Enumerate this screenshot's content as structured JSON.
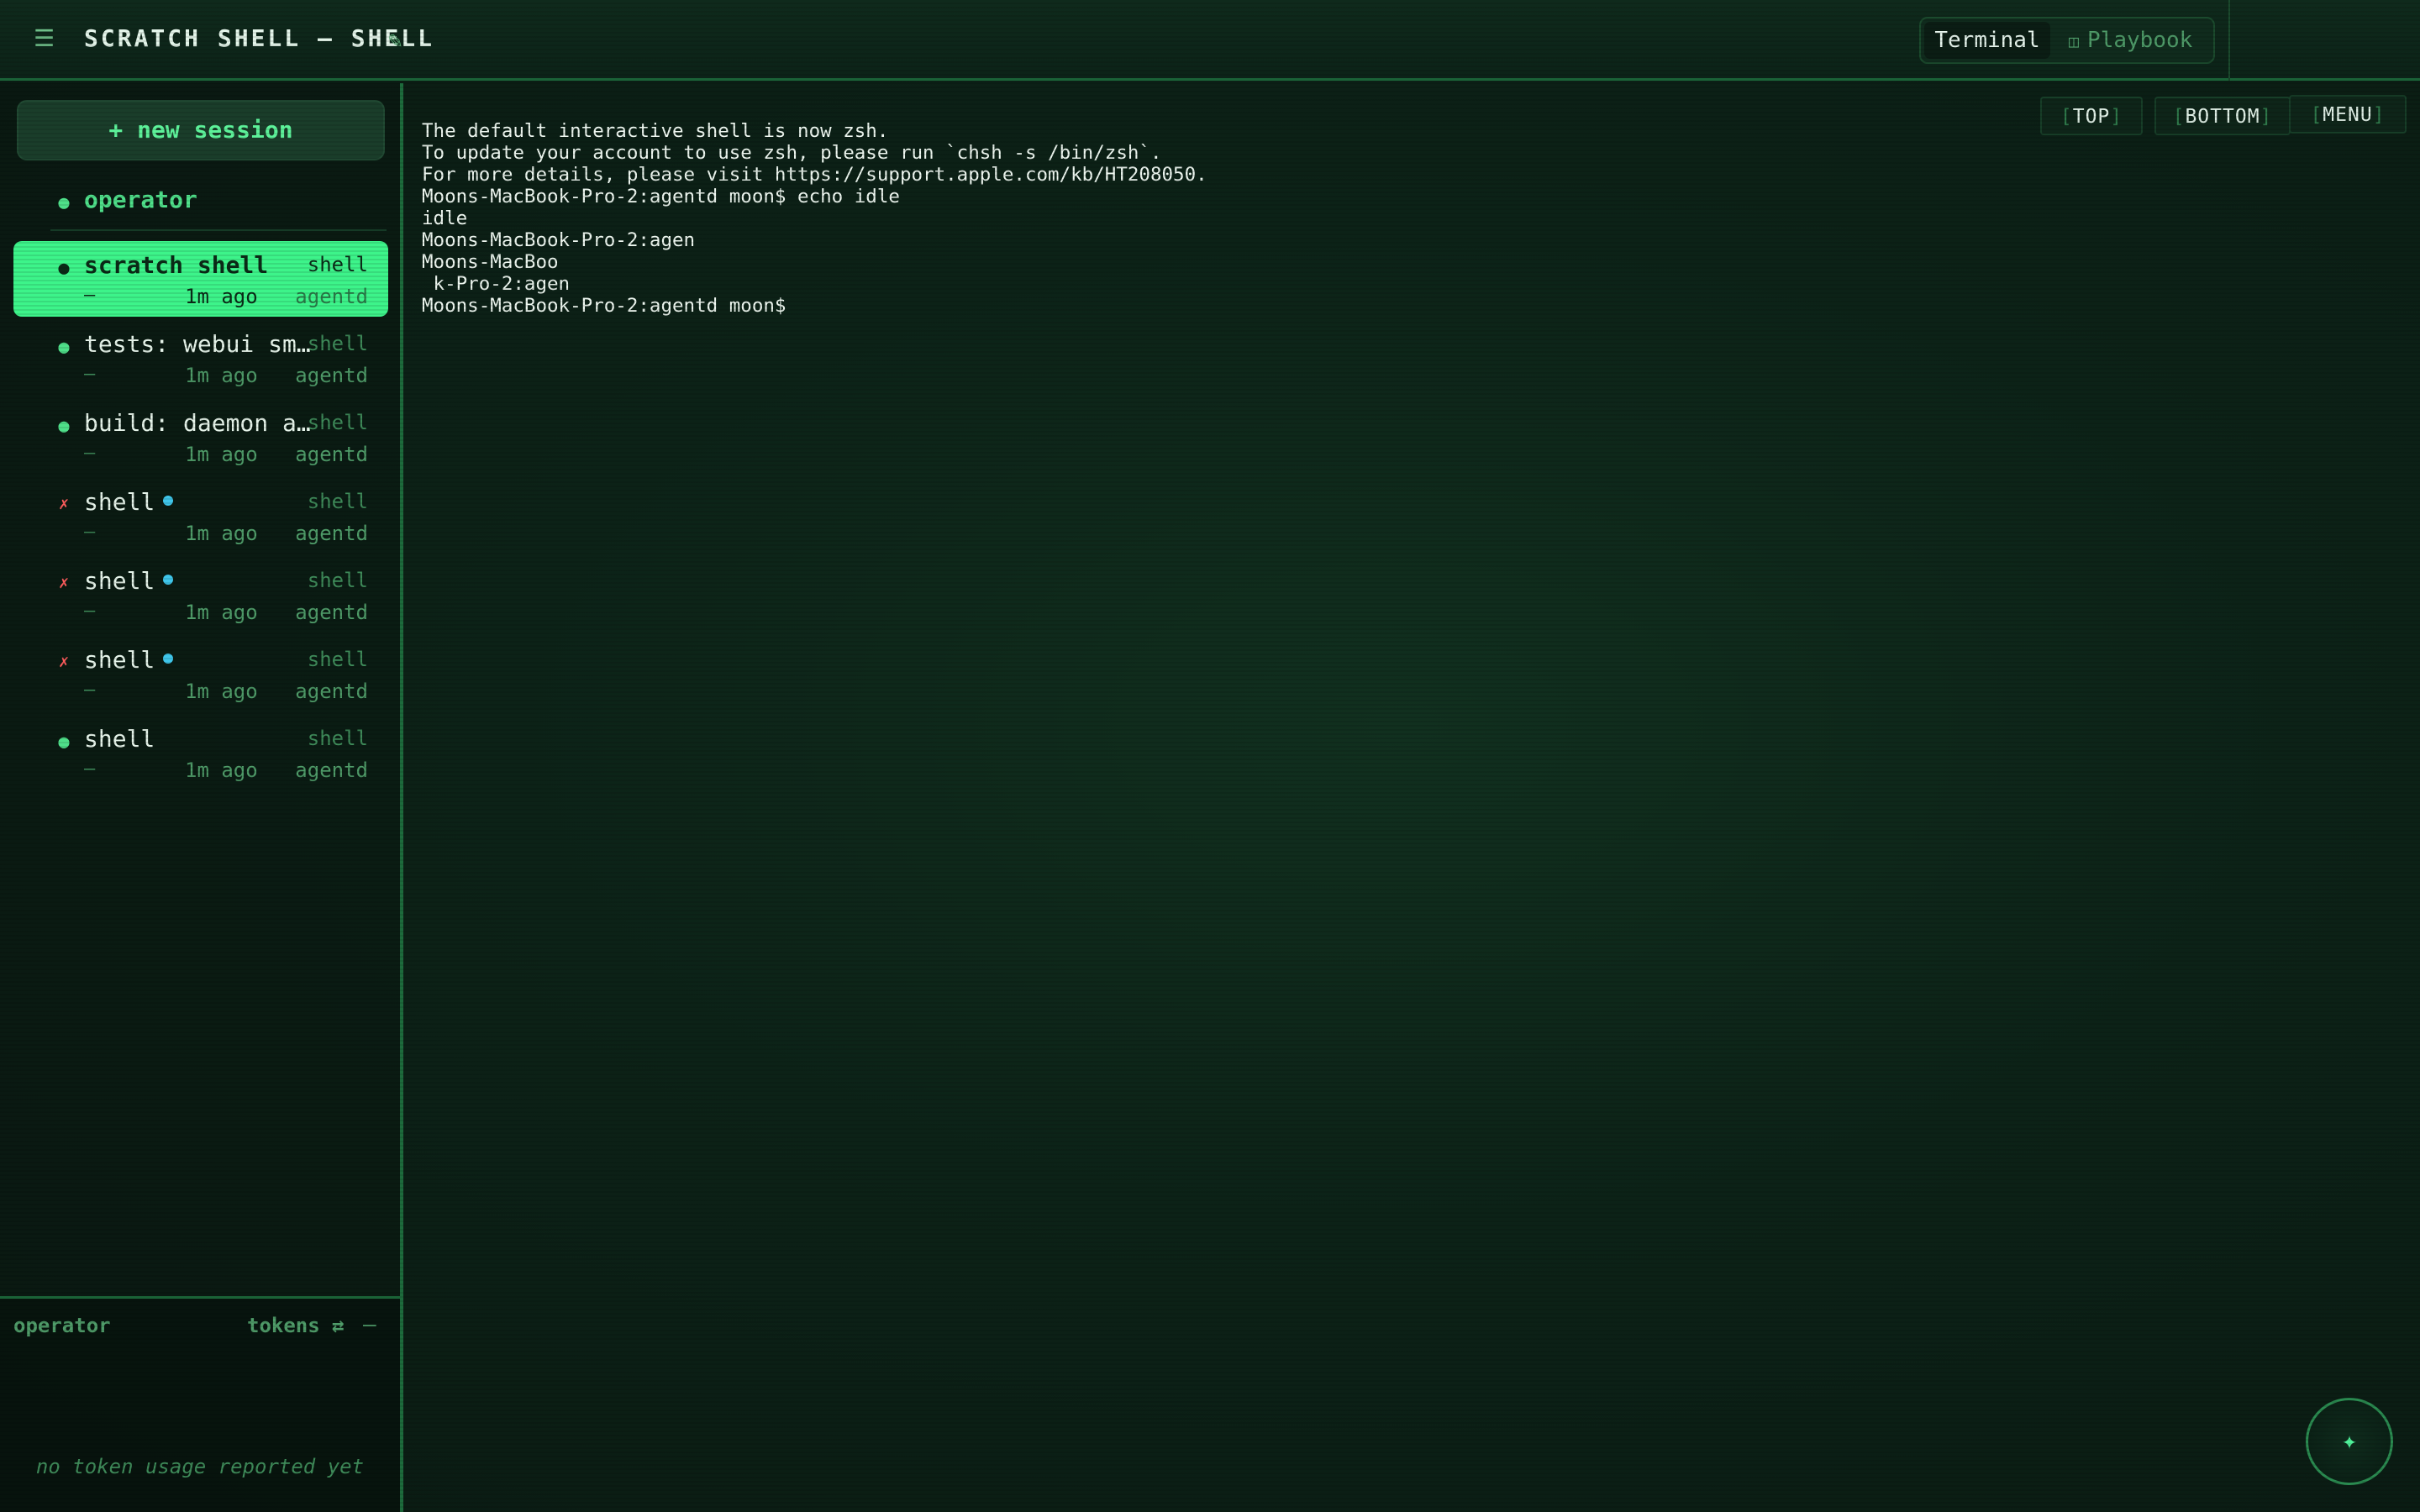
{
  "header": {
    "title": "SCRATCH SHELL — SHELL",
    "menu_icon": "☰",
    "edit_icon": "✎",
    "tabs": {
      "terminal": "Terminal",
      "playbook": "Playbook",
      "playbook_icon": "◫"
    }
  },
  "sidebar": {
    "new_session_label": "+ new session",
    "operator": {
      "dot": "●",
      "name": "operator"
    },
    "sessions": [
      {
        "status": "●",
        "name": "scratch shell",
        "kind": "shell",
        "dash": "—",
        "age": "1m ago",
        "owner": "agentd"
      },
      {
        "status": "●",
        "name": "tests: webui sm…",
        "kind": "shell",
        "dash": "—",
        "age": "1m ago",
        "owner": "agentd"
      },
      {
        "status": "●",
        "name": "build: daemon a…",
        "kind": "shell",
        "dash": "—",
        "age": "1m ago",
        "owner": "agentd"
      },
      {
        "status": "✗",
        "name": "shell",
        "kind": "shell",
        "dash": "—",
        "age": "1m ago",
        "owner": "agentd"
      },
      {
        "status": "✗",
        "name": "shell",
        "kind": "shell",
        "dash": "—",
        "age": "1m ago",
        "owner": "agentd"
      },
      {
        "status": "✗",
        "name": "shell",
        "kind": "shell",
        "dash": "—",
        "age": "1m ago",
        "owner": "agentd"
      },
      {
        "status": "●",
        "name": "shell",
        "kind": "shell",
        "dash": "—",
        "age": "1m ago",
        "owner": "agentd"
      }
    ]
  },
  "token_panel": {
    "operator": "operator",
    "label": "tokens ⇄",
    "collapse": "–",
    "empty": "no token usage reported yet"
  },
  "terminal": {
    "output": "The default interactive shell is now zsh.\nTo update your account to use zsh, please run `chsh -s /bin/zsh`.\nFor more details, please visit https://support.apple.com/kb/HT208050.\nMoons-MacBook-Pro-2:agentd moon$ echo idle\nidle\nMoons-MacBook-Pro-2:agen\nMoons-MacBoo\n k-Pro-2:agen\nMoons-MacBook-Pro-2:agentd moon$ ",
    "buttons": {
      "top": "TOP",
      "bottom": "BOTTOM",
      "menu": "MENU"
    },
    "fab_icon": "✦"
  },
  "colors": {
    "accent": "#3df48a",
    "border": "#1d6b3c",
    "error": "#ff5d5d",
    "busy": "#3fc6ea"
  }
}
